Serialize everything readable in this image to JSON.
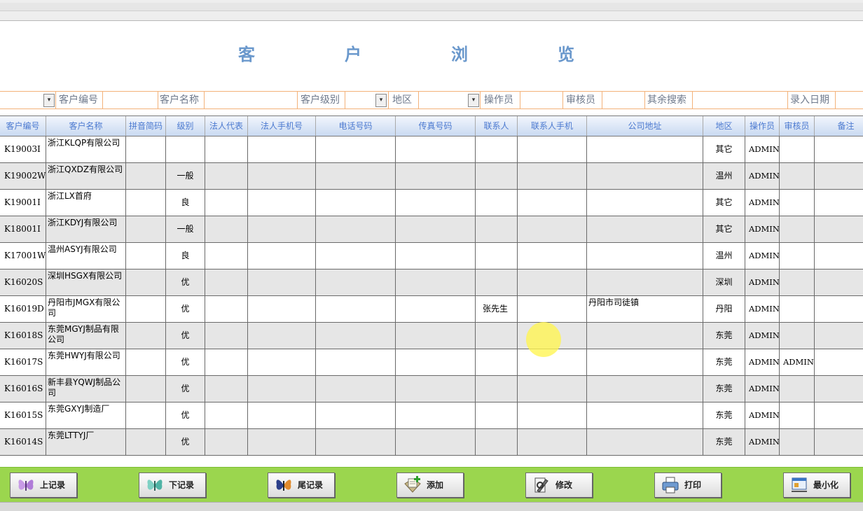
{
  "title": "客　户　浏　览",
  "filters": {
    "customer_code": "客户编号",
    "customer_name": "客户名称",
    "customer_level": "客户级别",
    "region": "地区",
    "operator": "操作员",
    "reviewer": "审核员",
    "other_search": "其余搜索",
    "entry_date": "录入日期",
    "dropdown_glyph": "▾"
  },
  "columns": [
    "客户编号",
    "客户名称",
    "拼音简码",
    "级别",
    "法人代表",
    "法人手机号",
    "电话号码",
    "传真号码",
    "联系人",
    "联系人手机",
    "公司地址",
    "地区",
    "操作员",
    "审核员",
    "备注"
  ],
  "rows": [
    {
      "code": "K19003I",
      "name": "浙江KLQP有限公司",
      "pinyin": "",
      "level": "",
      "legal": "",
      "legal_phone": "",
      "phone": "",
      "fax": "",
      "contact": "",
      "contact_phone": "",
      "address": "",
      "region": "其它",
      "operator": "ADMIN",
      "reviewer": "",
      "note": ""
    },
    {
      "code": "K19002W",
      "name": "浙江QXDZ有限公司",
      "pinyin": "",
      "level": "一般",
      "legal": "",
      "legal_phone": "",
      "phone": "",
      "fax": "",
      "contact": "",
      "contact_phone": "",
      "address": "",
      "region": "温州",
      "operator": "ADMIN",
      "reviewer": "",
      "note": ""
    },
    {
      "code": "K19001I",
      "name": "浙江LX首府",
      "pinyin": "",
      "level": "良",
      "legal": "",
      "legal_phone": "",
      "phone": "",
      "fax": "",
      "contact": "",
      "contact_phone": "",
      "address": "",
      "region": "其它",
      "operator": "ADMIN",
      "reviewer": "",
      "note": ""
    },
    {
      "code": "K18001I",
      "name": "浙江KDYJ有限公司",
      "pinyin": "",
      "level": "一般",
      "legal": "",
      "legal_phone": "",
      "phone": "",
      "fax": "",
      "contact": "",
      "contact_phone": "",
      "address": "",
      "region": "其它",
      "operator": "ADMIN",
      "reviewer": "",
      "note": ""
    },
    {
      "code": "K17001W",
      "name": "温州ASYJ有限公司",
      "pinyin": "",
      "level": "良",
      "legal": "",
      "legal_phone": "",
      "phone": "",
      "fax": "",
      "contact": "",
      "contact_phone": "",
      "address": "",
      "region": "温州",
      "operator": "ADMIN",
      "reviewer": "",
      "note": ""
    },
    {
      "code": "K16020S",
      "name": "深圳HSGX有限公司",
      "pinyin": "",
      "level": "优",
      "legal": "",
      "legal_phone": "",
      "phone": "",
      "fax": "",
      "contact": "",
      "contact_phone": "",
      "address": "",
      "region": "深圳",
      "operator": "ADMIN",
      "reviewer": "",
      "note": ""
    },
    {
      "code": "K16019D",
      "name": "丹阳市JMGX有限公司",
      "pinyin": "",
      "level": "优",
      "legal": "",
      "legal_phone": "",
      "phone": "",
      "fax": "",
      "contact": "张先生",
      "contact_phone": "",
      "address": "丹阳市司徒镇",
      "region": "丹阳",
      "operator": "ADMIN",
      "reviewer": "",
      "note": ""
    },
    {
      "code": "K16018S",
      "name": "东莞MGYJ制品有限公司",
      "pinyin": "",
      "level": "优",
      "legal": "",
      "legal_phone": "",
      "phone": "",
      "fax": "",
      "contact": "",
      "contact_phone": "",
      "address": "",
      "region": "东莞",
      "operator": "ADMIN",
      "reviewer": "",
      "note": ""
    },
    {
      "code": "K16017S",
      "name": "东莞HWYJ有限公司",
      "pinyin": "",
      "level": "优",
      "legal": "",
      "legal_phone": "",
      "phone": "",
      "fax": "",
      "contact": "",
      "contact_phone": "",
      "address": "",
      "region": "东莞",
      "operator": "ADMIN",
      "reviewer": "ADMIN",
      "note": ""
    },
    {
      "code": "K16016S",
      "name": "新丰县YQWJ制品公司",
      "pinyin": "",
      "level": "优",
      "legal": "",
      "legal_phone": "",
      "phone": "",
      "fax": "",
      "contact": "",
      "contact_phone": "",
      "address": "",
      "region": "东莞",
      "operator": "ADMIN",
      "reviewer": "",
      "note": ""
    },
    {
      "code": "K16015S",
      "name": "东莞GXYJ制造厂",
      "pinyin": "",
      "level": "优",
      "legal": "",
      "legal_phone": "",
      "phone": "",
      "fax": "",
      "contact": "",
      "contact_phone": "",
      "address": "",
      "region": "东莞",
      "operator": "ADMIN",
      "reviewer": "",
      "note": ""
    },
    {
      "code": "K16014S",
      "name": "东莞LTTYJ厂",
      "pinyin": "",
      "level": "优",
      "legal": "",
      "legal_phone": "",
      "phone": "",
      "fax": "",
      "contact": "",
      "contact_phone": "",
      "address": "",
      "region": "东莞",
      "operator": "ADMIN",
      "reviewer": "",
      "note": ""
    }
  ],
  "toolbar": {
    "prev": {
      "label": "上记录",
      "icon": "butterfly-icon"
    },
    "next": {
      "label": "下记录",
      "icon": "butterfly-icon"
    },
    "last": {
      "label": "尾记录",
      "icon": "butterfly-icon"
    },
    "add": {
      "label": "添加",
      "icon": "add-document-icon"
    },
    "edit": {
      "label": "修改",
      "icon": "edit-tool-icon"
    },
    "print": {
      "label": "打印",
      "icon": "printer-icon"
    },
    "minimize": {
      "label": "最小化",
      "icon": "window-icon"
    }
  },
  "colors": {
    "title": "#6a98cc",
    "header_text": "#4c7ad0",
    "filter_border": "#f3b27a",
    "toolbar_bg": "#9bd64e",
    "row_alt": "#e6e6e6"
  }
}
